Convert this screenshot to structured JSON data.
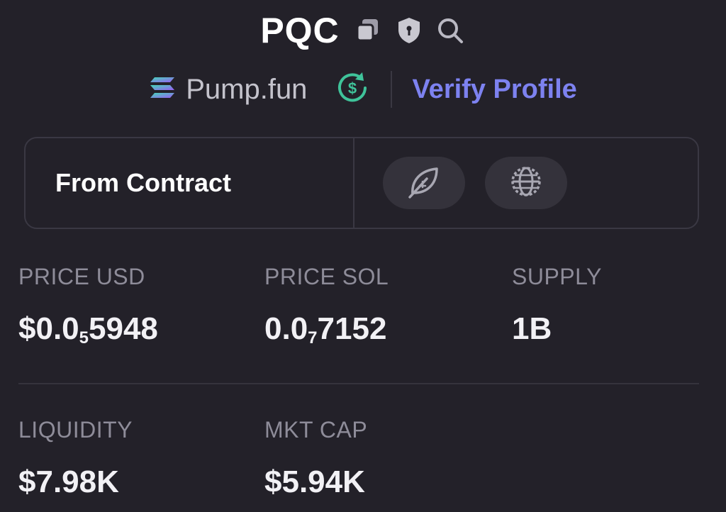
{
  "header": {
    "symbol": "PQC",
    "icons": [
      "copy-icon",
      "shield-icon",
      "search-icon"
    ]
  },
  "platform": {
    "name": "Pump.fun",
    "icon": "solana-icon",
    "badge_icon": "refresh-dollar-icon",
    "badge_color": "#3fc39a",
    "verify_label": "Verify Profile",
    "verify_color": "#7d82f0"
  },
  "contract": {
    "label": "From Contract",
    "actions": [
      "leaf-icon",
      "globe-icon"
    ]
  },
  "stats": {
    "price_usd": {
      "label": "PRICE USD",
      "prefix": "$0.0",
      "subscript": "5",
      "suffix": "5948"
    },
    "price_sol": {
      "label": "PRICE SOL",
      "prefix": "0.0",
      "subscript": "7",
      "suffix": "7152"
    },
    "supply": {
      "label": "SUPPLY",
      "value": "1B"
    },
    "liquidity": {
      "label": "LIQUIDITY",
      "value": "$7.98K"
    },
    "mkt_cap": {
      "label": "MKT CAP",
      "value": "$5.94K"
    }
  }
}
